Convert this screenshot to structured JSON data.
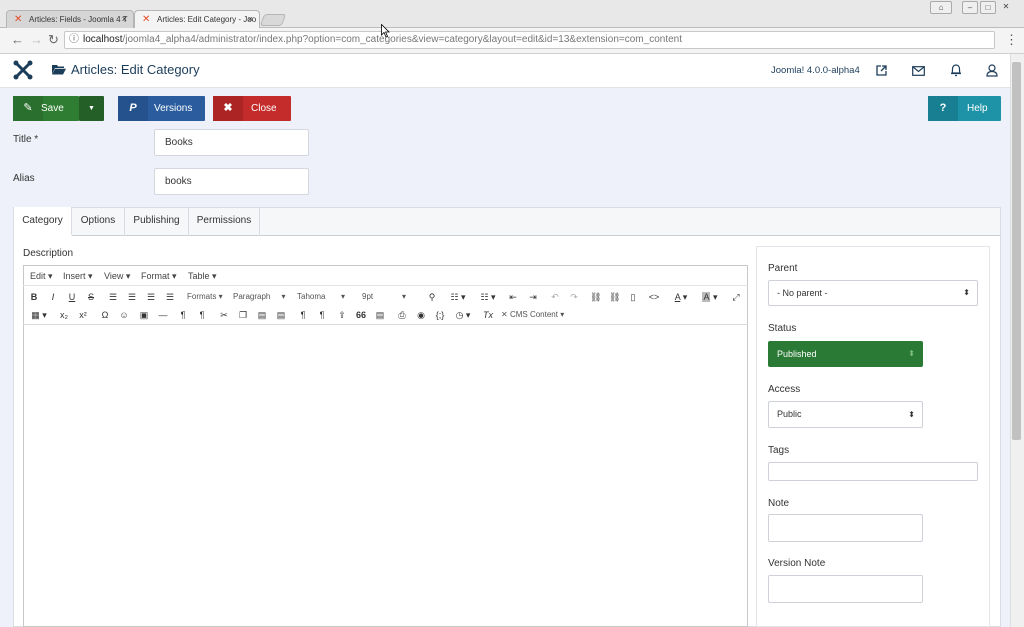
{
  "browser": {
    "tabs": [
      {
        "title": "Articles: Fields - Joomla 4 T",
        "close": "×"
      },
      {
        "title": "Articles: Edit Category - Joo",
        "close": "×"
      }
    ],
    "url_host": "localhost",
    "url_path": "/joomla4_alpha4/administrator/index.php?option=com_categories&view=category&layout=edit&id=13&extension=com_content"
  },
  "header": {
    "page_title": "Articles: Edit Category",
    "version": "Joomla! 4.0.0-alpha4"
  },
  "toolbar": {
    "save_label": "Save",
    "versions_label": "Versions",
    "close_label": "Close",
    "help_label": "Help",
    "help_icon": "?",
    "versions_icon": "P"
  },
  "form": {
    "title_label": "Title *",
    "title_value": "Books",
    "alias_label": "Alias",
    "alias_value": "books"
  },
  "tabs": [
    "Category",
    "Options",
    "Publishing",
    "Permissions"
  ],
  "editor": {
    "description_label": "Description",
    "menu": [
      "Edit",
      "Insert",
      "View",
      "Format",
      "Table"
    ],
    "formats": "Formats",
    "paragraph": "Paragraph",
    "font": "Tahoma",
    "size": "9pt",
    "cms_content": "CMS Content",
    "row1": [
      "B",
      "I",
      "U",
      "S"
    ],
    "row2_special": [
      "Ω",
      "☺"
    ],
    "code": "<>",
    "font_color": "A",
    "bg_color": "A",
    "braces": "{;}",
    "clear_format": "Tx",
    "blockquote": "66"
  },
  "side": {
    "parent_label": "Parent",
    "parent_value": "- No parent -",
    "status_label": "Status",
    "status_value": "Published",
    "access_label": "Access",
    "access_value": "Public",
    "tags_label": "Tags",
    "note_label": "Note",
    "version_note_label": "Version Note"
  },
  "colors": {
    "save": "#2f7d32",
    "versions": "#2b5d9e",
    "close": "#c42b2b",
    "help": "#1e93a8",
    "status": "#2a7a35"
  }
}
